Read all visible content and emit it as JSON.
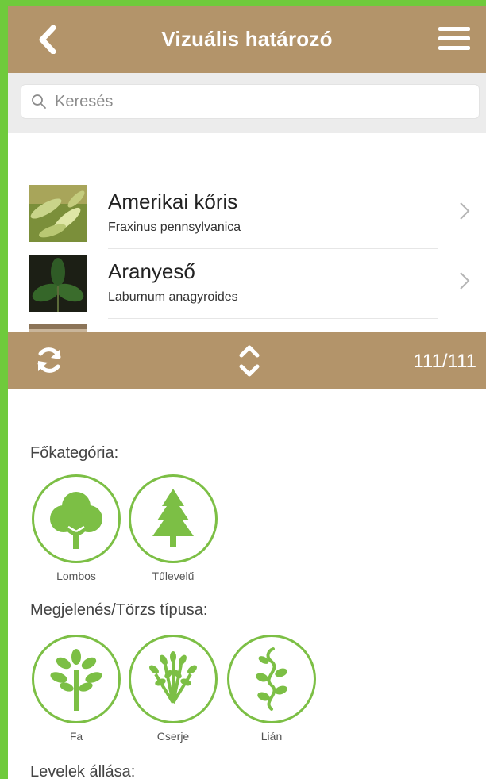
{
  "header": {
    "title": "Vizuális határozó"
  },
  "search": {
    "placeholder": "Keresés"
  },
  "species": [
    {
      "name": "Amerikai kőris",
      "latin": "Fraxinus pennsylvanica"
    },
    {
      "name": "Aranyeső",
      "latin": "Laburnum anagyroides"
    }
  ],
  "toolbar": {
    "count": "111/111"
  },
  "filters": {
    "main_category": {
      "title": "Főkategória:",
      "options": [
        {
          "label": "Lombos",
          "icon": "deciduous-tree-icon"
        },
        {
          "label": "Tűlevelű",
          "icon": "conifer-tree-icon"
        }
      ]
    },
    "appearance": {
      "title": "Megjelenés/Törzs típusa:",
      "options": [
        {
          "label": "Fa",
          "icon": "tree-icon"
        },
        {
          "label": "Cserje",
          "icon": "shrub-icon"
        },
        {
          "label": "Lián",
          "icon": "vine-icon"
        }
      ]
    },
    "leaf_arrangement": {
      "title": "Levelek állása:"
    }
  },
  "colors": {
    "bar": "#b3946a",
    "accent": "#7cbf45",
    "frame": "#6fca3c"
  }
}
